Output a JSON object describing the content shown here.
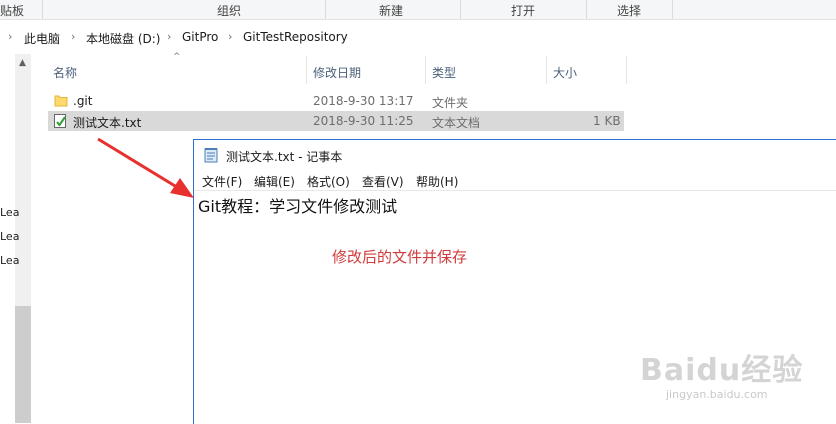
{
  "ribbon": {
    "groups": [
      "贴板",
      "组织",
      "新建",
      "打开",
      "选择"
    ]
  },
  "address": {
    "parts": [
      "此电脑",
      "本地磁盘 (D:)",
      "GitPro",
      "GitTestRepository"
    ]
  },
  "columns": [
    "名称",
    "修改日期",
    "类型",
    "大小"
  ],
  "files": [
    {
      "name": ".git",
      "modified": "2018-9-30 13:17",
      "type": "文件夹",
      "size": ""
    },
    {
      "name": "测试文本.txt",
      "modified": "2018-9-30 11:25",
      "type": "文本文档",
      "size": "1 KB"
    }
  ],
  "nav": {
    "items": [
      "Lea",
      "Lea",
      "Lea"
    ]
  },
  "notepad": {
    "title": "测试文本.txt - 记事本",
    "menu": [
      "文件(F)",
      "编辑(E)",
      "格式(O)",
      "查看(V)",
      "帮助(H)"
    ],
    "content": "Git教程：学习文件修改测试"
  },
  "annotation": {
    "text": "修改后的文件并保存",
    "color": "#d13b3b"
  },
  "watermark": {
    "brand": "Baidu经验",
    "url": "jingyan.baidu.com"
  }
}
